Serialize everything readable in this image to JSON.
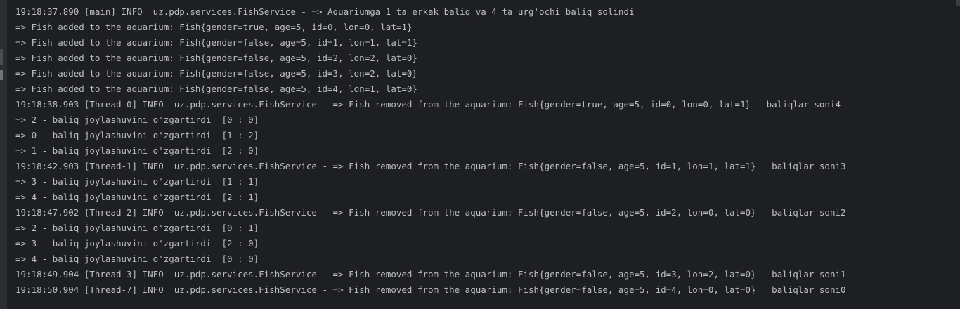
{
  "console": {
    "lines": [
      "19:18:37.890 [main] INFO  uz.pdp.services.FishService - => Aquariumga 1 ta erkak baliq va 4 ta urg'ochi baliq solindi",
      "=> Fish added to the aquarium: Fish{gender=true, age=5, id=0, lon=0, lat=1}",
      "=> Fish added to the aquarium: Fish{gender=false, age=5, id=1, lon=1, lat=1}",
      "=> Fish added to the aquarium: Fish{gender=false, age=5, id=2, lon=2, lat=0}",
      "=> Fish added to the aquarium: Fish{gender=false, age=5, id=3, lon=2, lat=0}",
      "=> Fish added to the aquarium: Fish{gender=false, age=5, id=4, lon=1, lat=0}",
      "19:18:38.903 [Thread-0] INFO  uz.pdp.services.FishService - => Fish removed from the aquarium: Fish{gender=true, age=5, id=0, lon=0, lat=1}   baliqlar soni4",
      "=> 2 - baliq joylashuvini o'zgartirdi  [0 : 0]",
      "=> 0 - baliq joylashuvini o'zgartirdi  [1 : 2]",
      "=> 1 - baliq joylashuvini o'zgartirdi  [2 : 0]",
      "19:18:42.903 [Thread-1] INFO  uz.pdp.services.FishService - => Fish removed from the aquarium: Fish{gender=false, age=5, id=1, lon=1, lat=1}   baliqlar soni3",
      "=> 3 - baliq joylashuvini o'zgartirdi  [1 : 1]",
      "=> 4 - baliq joylashuvini o'zgartirdi  [2 : 1]",
      "19:18:47.902 [Thread-2] INFO  uz.pdp.services.FishService - => Fish removed from the aquarium: Fish{gender=false, age=5, id=2, lon=0, lat=0}   baliqlar soni2",
      "=> 2 - baliq joylashuvini o'zgartirdi  [0 : 1]",
      "=> 3 - baliq joylashuvini o'zgartirdi  [2 : 0]",
      "=> 4 - baliq joylashuvini o'zgartirdi  [0 : 0]",
      "19:18:49.904 [Thread-3] INFO  uz.pdp.services.FishService - => Fish removed from the aquarium: Fish{gender=false, age=5, id=3, lon=2, lat=0}   baliqlar soni1",
      "19:18:50.904 [Thread-7] INFO  uz.pdp.services.FishService - => Fish removed from the aquarium: Fish{gender=false, age=5, id=4, lon=0, lat=0}   baliqlar soni0"
    ]
  },
  "colors": {
    "background": "#1e1f22",
    "gutter": "#2b2d30",
    "text": "#bcbec4"
  }
}
